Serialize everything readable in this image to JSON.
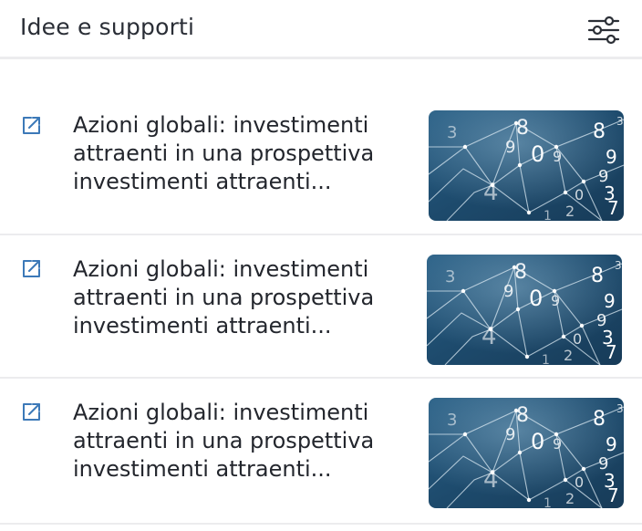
{
  "header": {
    "title": "Idee e supporti",
    "filter_icon": "sliders-filter-icon"
  },
  "colors": {
    "accent": "#3c79b8",
    "divider": "#ececee",
    "text": "#23262d",
    "thumb_bg": "#1f4f73"
  },
  "items": [
    {
      "line1": "Azioni globali: investimenti",
      "line2": "attraenti in una prospettiva",
      "line3": "investimenti attraenti...",
      "icon": "external-link-icon",
      "thumbnail": "network-numbers-image"
    },
    {
      "line1": "Azioni globali: investimenti",
      "line2": "attraenti in una prospettiva",
      "line3": "investimenti attraenti...",
      "icon": "external-link-icon",
      "thumbnail": "network-numbers-image"
    },
    {
      "line1": "Azioni globali: investimenti",
      "line2": "attraenti in una prospettiva",
      "line3": "investimenti attraenti...",
      "icon": "external-link-icon",
      "thumbnail": "network-numbers-image"
    }
  ]
}
